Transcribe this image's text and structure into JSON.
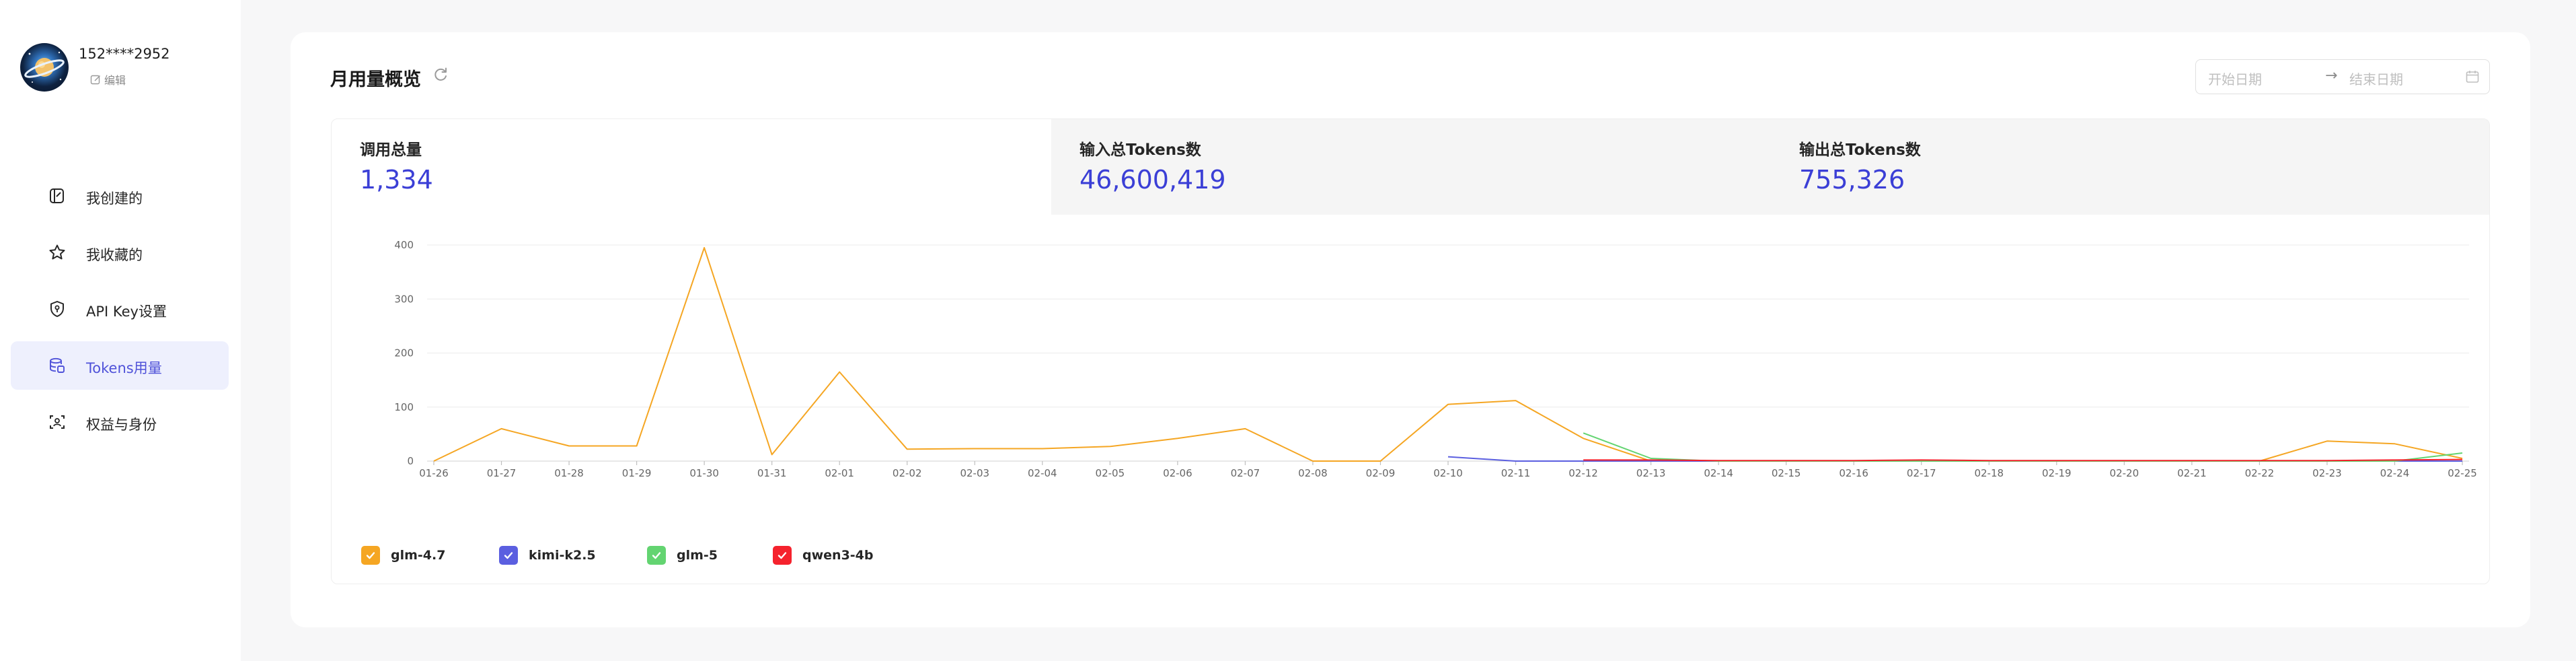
{
  "profile": {
    "phone": "152****2952",
    "edit_label": "编辑"
  },
  "sidebar": {
    "items": [
      {
        "label": "我创建的",
        "icon": "created-icon"
      },
      {
        "label": "我收藏的",
        "icon": "star-icon"
      },
      {
        "label": "API Key设置",
        "icon": "shield-key-icon"
      },
      {
        "label": "Tokens用量",
        "icon": "database-icon",
        "active": true
      },
      {
        "label": "权益与身份",
        "icon": "id-scan-icon"
      }
    ]
  },
  "card": {
    "title": "月用量概览",
    "date_start_placeholder": "开始日期",
    "date_end_placeholder": "结束日期",
    "date_arrow": "→"
  },
  "stats": [
    {
      "label": "调用总量",
      "value": "1,334"
    },
    {
      "label": "输入总Tokens数",
      "value": "46,600,419"
    },
    {
      "label": "输出总Tokens数",
      "value": "755,326"
    }
  ],
  "colors": {
    "accent": "#4f52d9",
    "stat_value": "#3b3fd6"
  },
  "chart_data": {
    "type": "line",
    "categories": [
      "01-26",
      "01-27",
      "01-28",
      "01-29",
      "01-30",
      "01-31",
      "02-01",
      "02-02",
      "02-03",
      "02-04",
      "02-05",
      "02-06",
      "02-07",
      "02-08",
      "02-09",
      "02-10",
      "02-11",
      "02-12",
      "02-13",
      "02-14",
      "02-15",
      "02-16",
      "02-17",
      "02-18",
      "02-19",
      "02-20",
      "02-21",
      "02-22",
      "02-23",
      "02-24",
      "02-25"
    ],
    "ylim": [
      0,
      400
    ],
    "yticks": [
      0,
      100,
      200,
      300,
      400
    ],
    "grid": true,
    "legend_position": "bottom-left",
    "series": [
      {
        "name": "glm-4.7",
        "color": "#f5a623",
        "values": [
          0,
          60,
          28,
          28,
          395,
          12,
          165,
          22,
          23,
          23,
          27,
          42,
          60,
          0,
          0,
          105,
          112,
          42,
          0,
          0,
          0,
          0,
          0,
          0,
          0,
          0,
          0,
          0,
          37,
          32,
          5
        ]
      },
      {
        "name": "kimi-k2.5",
        "color": "#5b5fe0",
        "values": [
          null,
          null,
          null,
          null,
          null,
          null,
          null,
          null,
          null,
          null,
          null,
          null,
          null,
          null,
          null,
          8,
          0,
          0,
          0,
          0,
          0,
          0,
          0,
          0,
          0,
          0,
          0,
          0,
          0,
          0,
          0
        ]
      },
      {
        "name": "glm-5",
        "color": "#63d471",
        "values": [
          null,
          null,
          null,
          null,
          null,
          null,
          null,
          null,
          null,
          null,
          null,
          null,
          null,
          null,
          null,
          null,
          null,
          52,
          5,
          0,
          0,
          0,
          0,
          0,
          0,
          0,
          0,
          0,
          0,
          0,
          15
        ]
      },
      {
        "name": "qwen3-4b",
        "color": "#f5222d",
        "values": [
          null,
          null,
          null,
          null,
          null,
          null,
          null,
          null,
          null,
          null,
          null,
          null,
          null,
          null,
          null,
          null,
          null,
          2,
          2,
          1,
          1,
          1,
          2,
          1,
          1,
          1,
          1,
          1,
          1,
          2,
          3
        ]
      }
    ]
  }
}
